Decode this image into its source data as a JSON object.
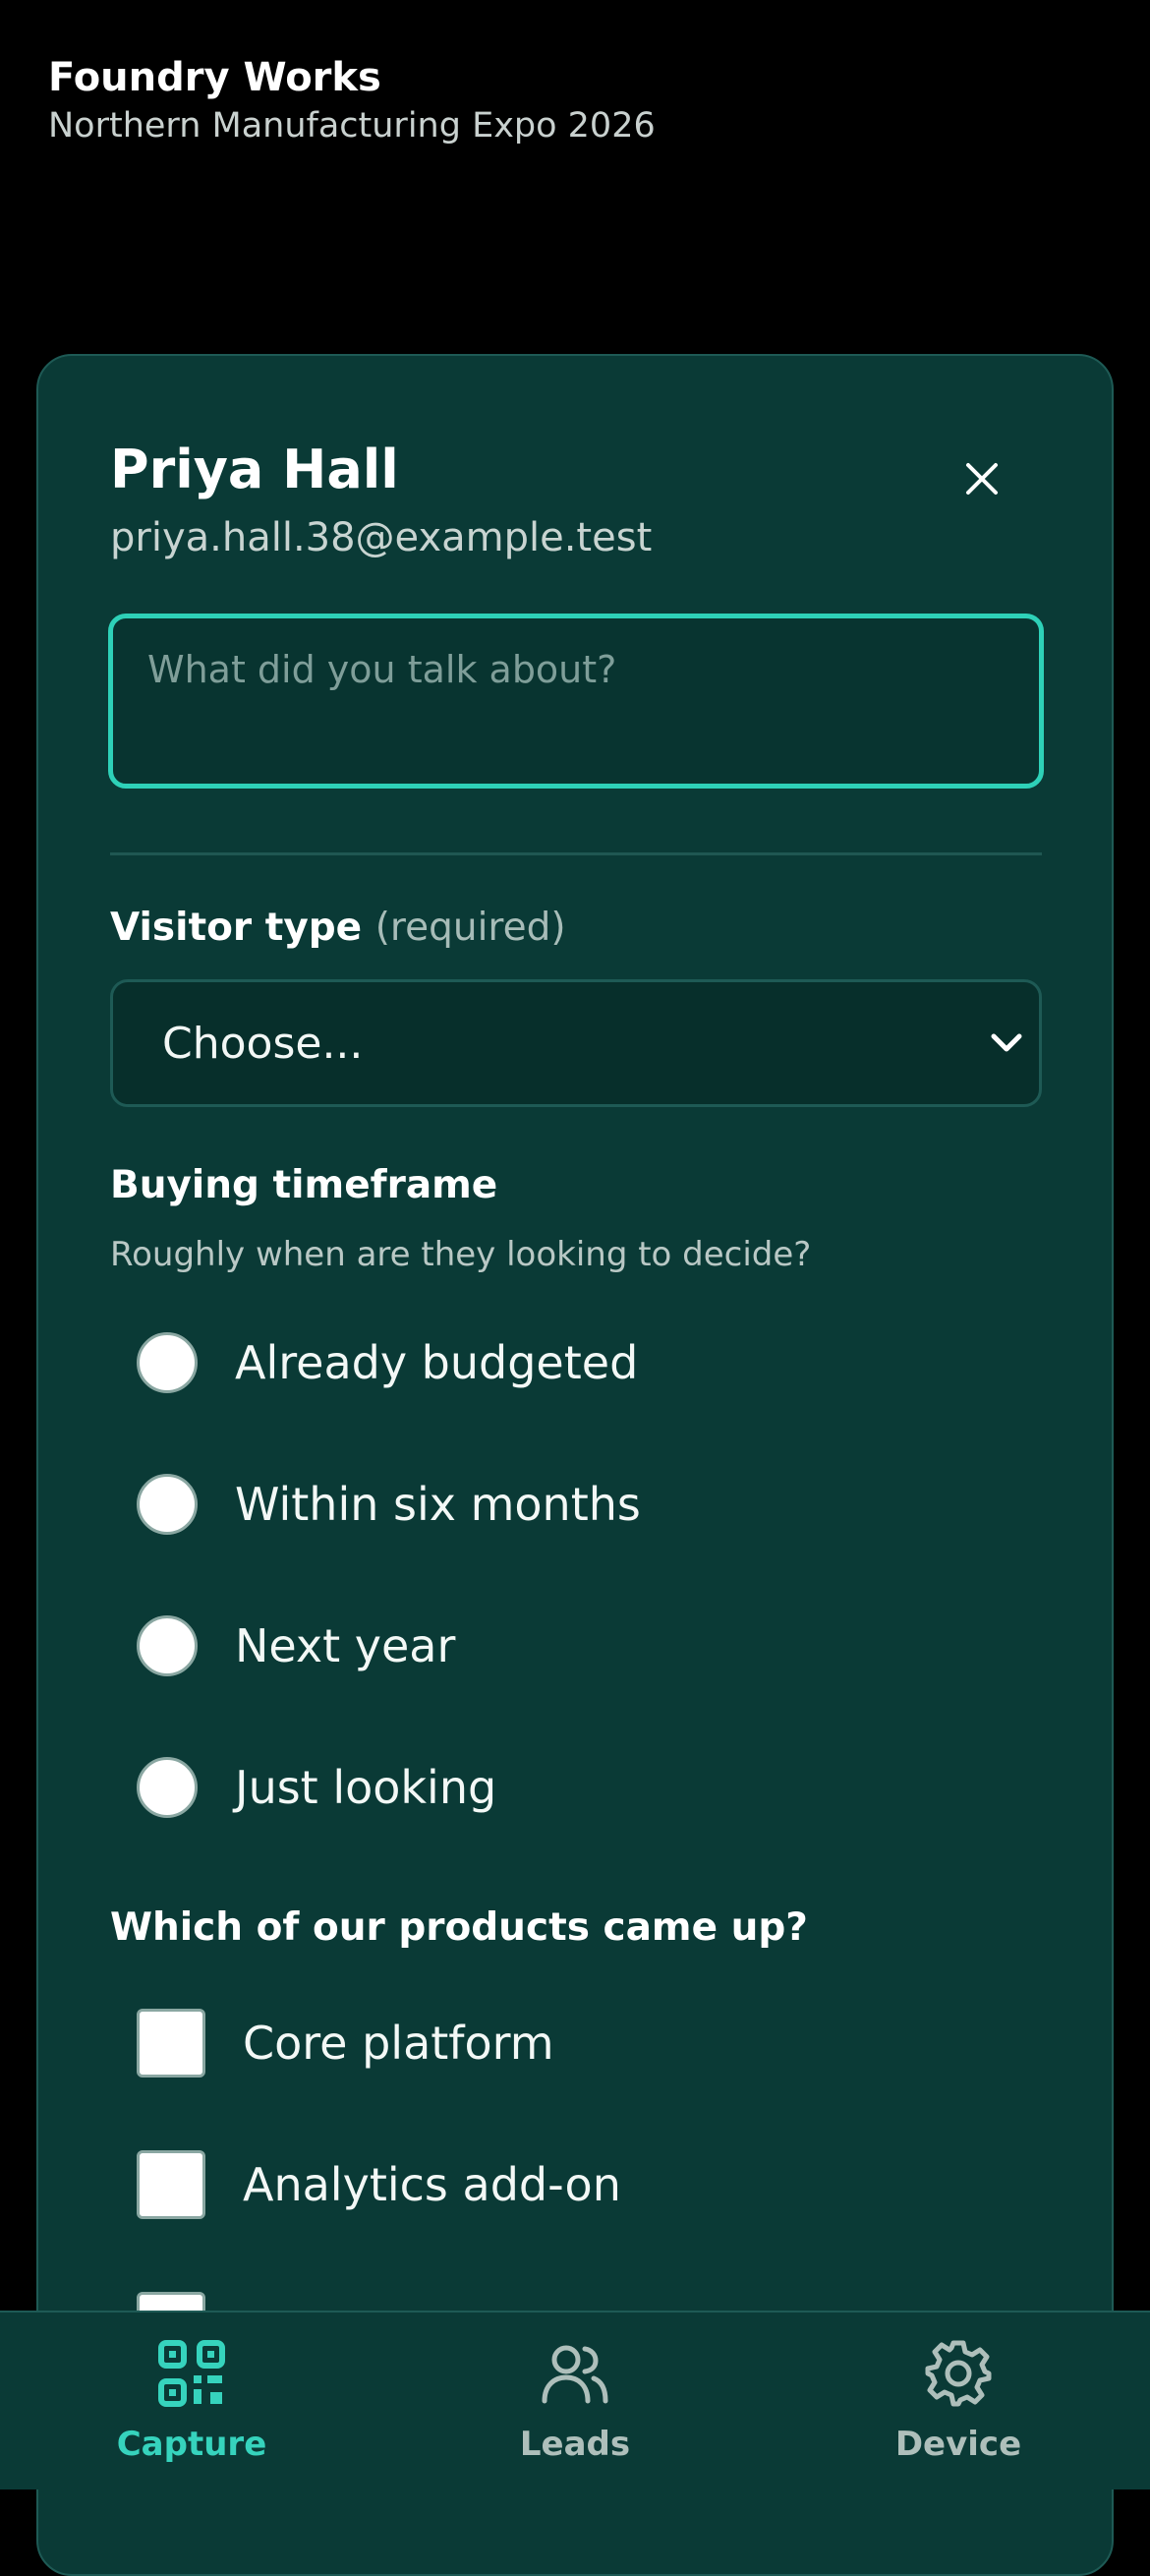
{
  "header": {
    "org_name": "Foundry Works",
    "event_name": "Northern Manufacturing Expo 2026"
  },
  "contact": {
    "name": "Priya Hall",
    "email": "priya.hall.38@example.test"
  },
  "notes": {
    "placeholder": "What did you talk about?",
    "value": ""
  },
  "visitor_type": {
    "label": "Visitor type",
    "required_note": "(required)",
    "selected": "Choose..."
  },
  "buying_timeframe": {
    "label": "Buying timeframe",
    "hint": "Roughly when are they looking to decide?",
    "options": [
      {
        "label": "Already budgeted",
        "selected": false
      },
      {
        "label": "Within six months",
        "selected": false
      },
      {
        "label": "Next year",
        "selected": false
      },
      {
        "label": "Just looking",
        "selected": false
      }
    ]
  },
  "products": {
    "label": "Which of our products came up?",
    "options": [
      {
        "label": "Core platform",
        "checked": false
      },
      {
        "label": "Analytics add-on",
        "checked": false
      },
      {
        "label": "",
        "checked": false
      }
    ]
  },
  "tabs": [
    {
      "label": "Capture",
      "icon": "qr-code-icon",
      "active": true
    },
    {
      "label": "Leads",
      "icon": "users-icon",
      "active": false
    },
    {
      "label": "Device",
      "icon": "gear-icon",
      "active": false
    }
  ],
  "colors": {
    "accent": "#36d3bd",
    "background": "#000000",
    "sheet": "#0a3a36",
    "focus_border": "#2ed1b8"
  }
}
